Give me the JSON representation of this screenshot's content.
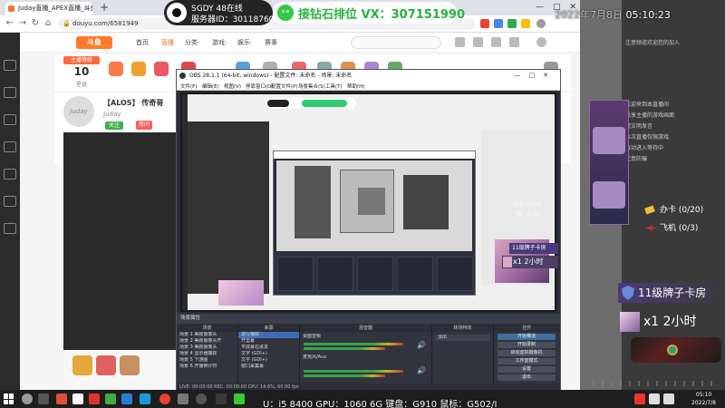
{
  "browser": {
    "tab_title": "Juday直播_APEX直播_斗鱼直播",
    "new_tab": "+",
    "url": "douyu.com/6581949",
    "window_controls": [
      "—",
      "□",
      "✕"
    ],
    "nav_icons": [
      "←",
      "→",
      "↻",
      "⌂"
    ]
  },
  "douyu": {
    "nav": [
      "首页",
      "直播",
      "分类·",
      "游戏·",
      "娱乐·",
      "赛事"
    ],
    "room_level_label": "主播等级",
    "room_level": "10",
    "room_level_sub": "星级",
    "room_title": "【ALOS】 传奇哥",
    "streamer_name": "Juday",
    "tag_follow": "关注",
    "tag_room": "房间"
  },
  "watermark": {
    "sgdy_line1": "SGDY 48在线",
    "sgdy_line2": "服务器ID：30118760",
    "vx_text": "接钻石排位 VX：307151990"
  },
  "clock": {
    "date": "2022年7月8日",
    "time": "05:10:23"
  },
  "obs": {
    "title": "OBS 28.1.1 (64-bit, windows) - 配置文件: 未命名 - 场景: 未命名",
    "menu": [
      "文件(F)",
      "编辑(E)",
      "视图(V)",
      "停靠窗口(D)",
      "配置文件(P)",
      "场景集合(S)",
      "工具(T)",
      "帮助(H)"
    ],
    "scene_bar": "场景属性",
    "docks": {
      "scenes_h": "场景",
      "sources_h": "来源",
      "mixer_h": "混音器",
      "transitions_h": "转场特效",
      "controls_h": "控件"
    },
    "scenes": [
      "场景 1 美颜摄像头",
      "场景 2 美颜摄像头开",
      "场景 3 美颜摄像头",
      "场景 4 显示器捕获",
      "场景 5 下游图",
      "场景 6 开播倒计时"
    ],
    "sources": [
      "进行捕获",
      "开里幕",
      "平底幕右进发",
      "文字 (GDI+)",
      "文字 (GDI+)",
      "窗口采集幕"
    ],
    "mixer": [
      "桌面音频",
      "麦克风/Aux"
    ],
    "transition": "淡出",
    "controls": [
      "开始推流",
      "开始录制",
      "启动虚拟摄像机",
      "工作室模式",
      "设置",
      "退出"
    ],
    "status": "LIVE: 00:00:00   REC: 00:00:00   CPU: 14.6%, 60.00 fps"
  },
  "overlay": {
    "card_1": "办卡 (0/20)",
    "card_2": "飞机 (0/3)",
    "level_badge": "11级牌子卡房",
    "x1_big": "x1  2小时",
    "x1_small": "x1  2小时",
    "level_small": "11级牌子卡房",
    "hw_text": "U：i5 8400 GPU：1060 6G 键盘：G910 鼠标：G502/I"
  },
  "chat": {
    "messages": [
      "注意频道欢迎您的加入",
      "欢迎来到本直播间",
      "共享主播的游戏画面",
      "请文明发言",
      "本次直播仅限游戏",
      "自动进入等待中",
      "注意防骗"
    ]
  },
  "taskbar": {
    "time": "05:10",
    "date": "2022/7/8"
  }
}
